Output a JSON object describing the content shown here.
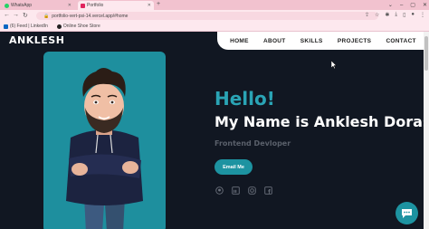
{
  "browser": {
    "tabs": [
      {
        "title": "WhatsApp",
        "active": false,
        "icon": "whatsapp-icon",
        "color": "#25d366"
      },
      {
        "title": "Portfolio",
        "active": true,
        "icon": "portfolio-icon",
        "color": "#e0245e"
      }
    ],
    "url": "portfolio-vert-psi-14.vercel.app/#home",
    "bookmarks": [
      {
        "label": "(6) Feed | LinkedIn",
        "icon": "linkedin-icon"
      },
      {
        "label": "Online Shoe Store",
        "icon": "github-icon"
      }
    ]
  },
  "site": {
    "logo": "ANKLESH",
    "nav": [
      "HOME",
      "ABOUT",
      "SKILLS",
      "PROJECTS",
      "CONTACT"
    ],
    "greeting": "Hello!",
    "name": "My Name is Anklesh Doras",
    "role": "Frontend Devloper",
    "email_button": "Email Me",
    "socials": [
      "github-icon",
      "linkedin-icon",
      "instagram-icon",
      "facebook-icon"
    ],
    "accent": "#1d93a1",
    "background": "#111722"
  }
}
